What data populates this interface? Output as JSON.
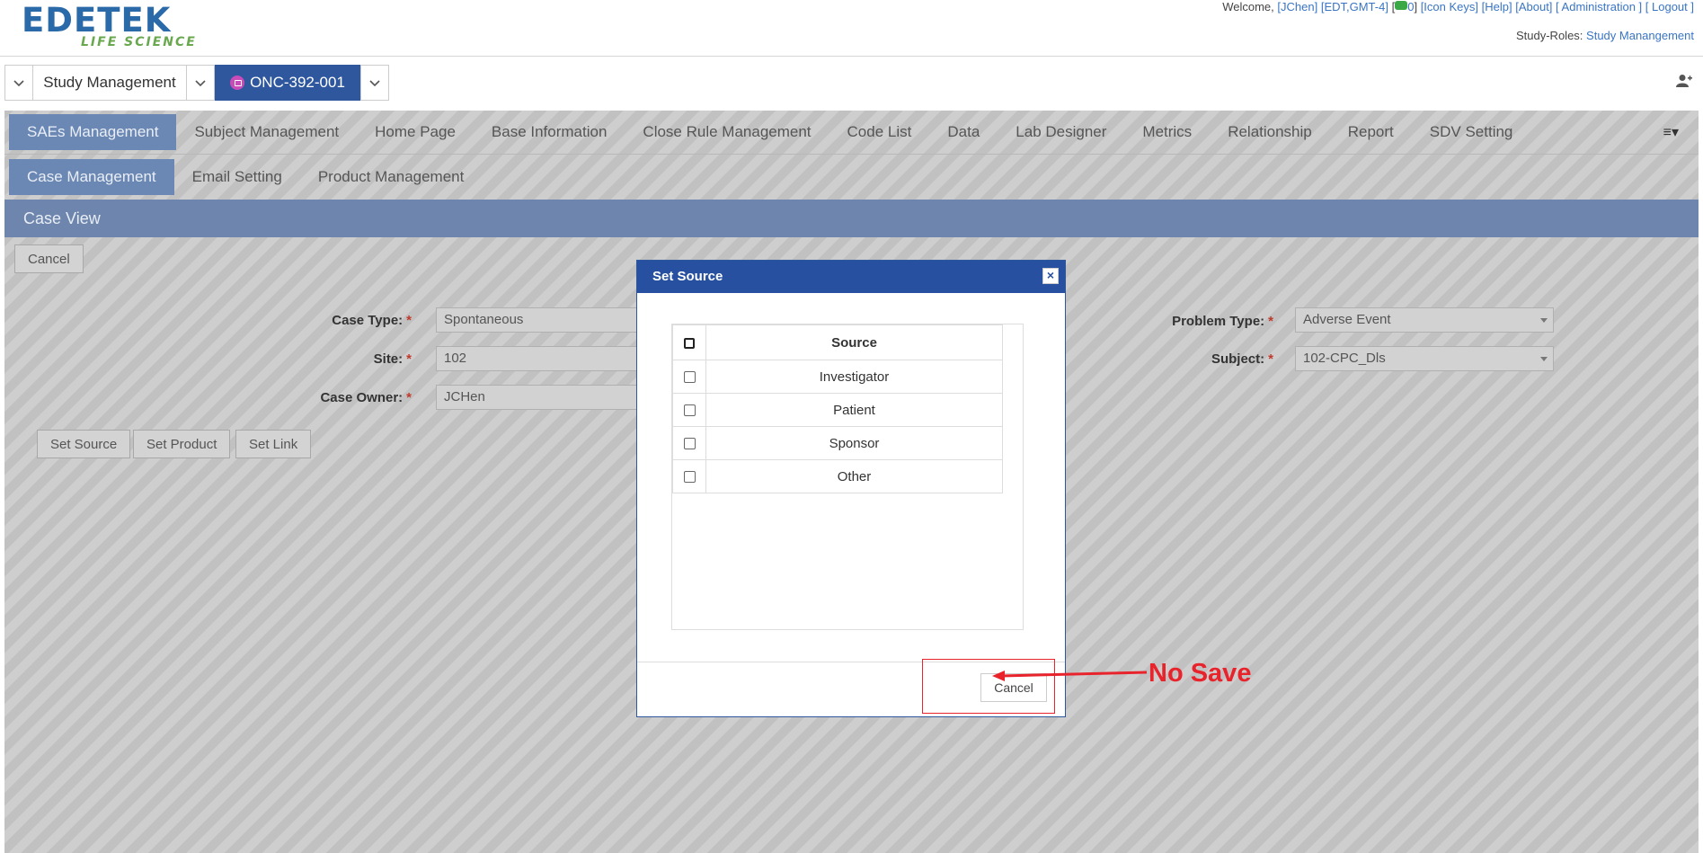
{
  "header": {
    "logo_main": "EDETEK",
    "logo_sub": "LIFE SCIENCE",
    "welcome": "Welcome,",
    "user_link": "[JChen]",
    "timezone_link": "[EDT,GMT-4]",
    "mail_count": "0",
    "icon_keys": "[Icon Keys]",
    "help": "[Help]",
    "about": "[About]",
    "administration": "[ Administration ]",
    "logout": "[ Logout ]",
    "roles_label": "Study-Roles:",
    "roles_value": "Study Manangement"
  },
  "studybar": {
    "study_label": "Study Management",
    "protocol": "ONC-392-001"
  },
  "nav": {
    "row1": [
      "SAEs Management",
      "Subject Management",
      "Home Page",
      "Base Information",
      "Close Rule Management",
      "Code List",
      "Data",
      "Lab Designer",
      "Metrics",
      "Relationship",
      "Report",
      "SDV Setting"
    ],
    "row2": [
      "Case Management",
      "Email Setting",
      "Product Management"
    ]
  },
  "page": {
    "title": "Case View",
    "cancel_button": "Cancel",
    "form": {
      "case_type_label": "Case Type:",
      "case_type_value": "Spontaneous",
      "site_label": "Site:",
      "site_value": "102",
      "case_owner_label": "Case Owner:",
      "case_owner_value": "JCHen",
      "problem_type_label": "Problem Type:",
      "problem_type_value": "Adverse Event",
      "subject_label": "Subject:",
      "subject_value": "102-CPC_Dls",
      "required_mark": "*"
    },
    "actions": {
      "set_source": "Set Source",
      "set_product": "Set Product",
      "set_link": "Set Link"
    }
  },
  "modal": {
    "title": "Set Source",
    "column_header": "Source",
    "rows": [
      "Investigator",
      "Patient",
      "Sponsor",
      "Other"
    ],
    "cancel_button": "Cancel"
  },
  "annotation": {
    "text": "No Save",
    "color": "#e8232b"
  },
  "colors": {
    "primary": "#2750a0",
    "nav_active": "#6b88b4",
    "link": "#3a75c4"
  }
}
